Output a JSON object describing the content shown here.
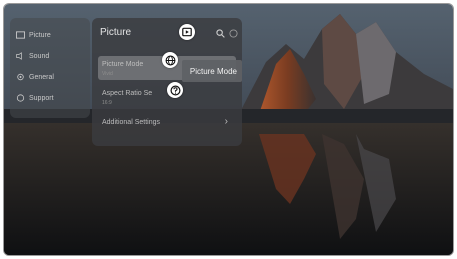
{
  "side_menu": {
    "items": [
      {
        "label": "Picture",
        "icon": "picture-icon"
      },
      {
        "label": "Sound",
        "icon": "speaker-icon"
      },
      {
        "label": "General",
        "icon": "gear-icon"
      },
      {
        "label": "Support",
        "icon": "support-icon"
      }
    ]
  },
  "panel": {
    "title": "Picture",
    "header_icons": [
      "search-icon",
      "help-icon"
    ],
    "rows": [
      {
        "label": "Picture Mode",
        "value": "Vivid"
      },
      {
        "label": "Aspect Ratio Se",
        "value": "16:9"
      },
      {
        "label": "Additional Settings",
        "value": ""
      }
    ],
    "additional_arrow": "›"
  },
  "tooltip": {
    "label": "Picture Mode"
  },
  "overlay_icons": [
    "play-icon",
    "globe-icon",
    "question-icon"
  ],
  "colors": {
    "panel": "#3a3c40",
    "selected_row": "#7d7f83",
    "text": "#e4e4e4"
  }
}
